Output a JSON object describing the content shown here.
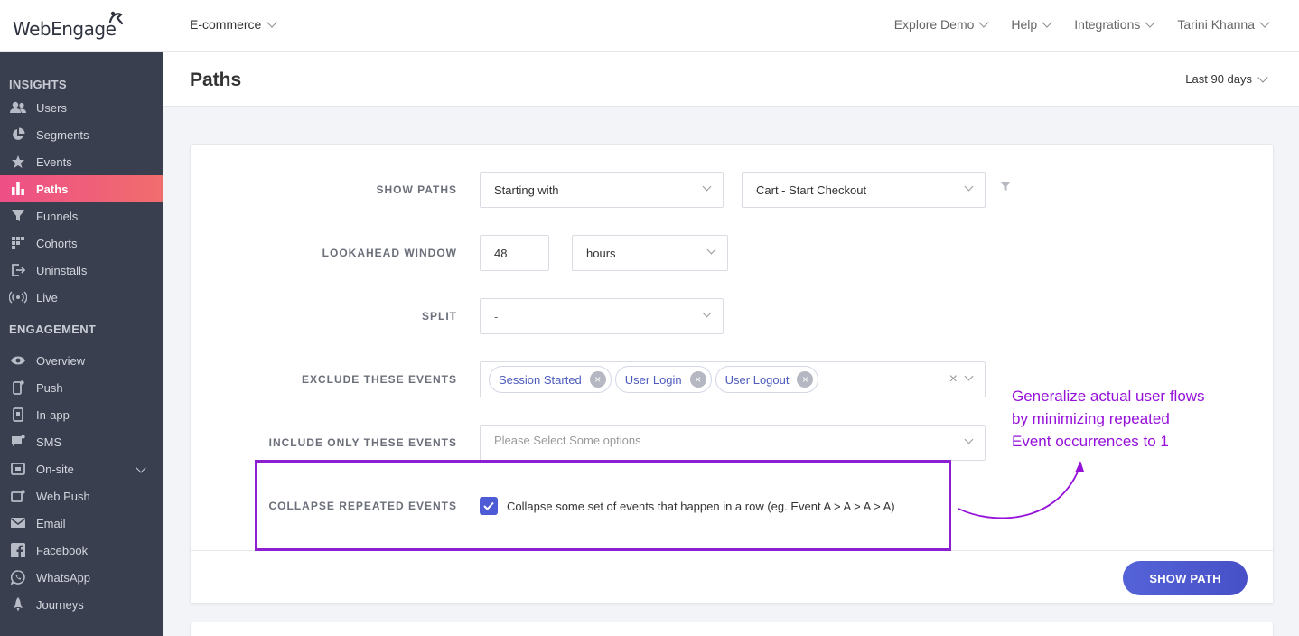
{
  "brand": {
    "name": "WebEngage"
  },
  "topbar": {
    "project": "E-commerce",
    "nav": [
      "Explore Demo",
      "Help",
      "Integrations",
      "Tarini Khanna"
    ]
  },
  "sidebar": {
    "insights_title": "INSIGHTS",
    "insights": [
      {
        "label": "Users",
        "icon": "users-icon"
      },
      {
        "label": "Segments",
        "icon": "pie-icon"
      },
      {
        "label": "Events",
        "icon": "star-icon"
      },
      {
        "label": "Paths",
        "icon": "bar-chart-icon",
        "active": true
      },
      {
        "label": "Funnels",
        "icon": "funnel-icon"
      },
      {
        "label": "Cohorts",
        "icon": "grid-icon"
      },
      {
        "label": "Uninstalls",
        "icon": "exit-icon"
      },
      {
        "label": "Live",
        "icon": "broadcast-icon"
      }
    ],
    "engagement_title": "ENGAGEMENT",
    "engagement": [
      {
        "label": "Overview",
        "icon": "eye-icon"
      },
      {
        "label": "Push",
        "icon": "mobile-icon"
      },
      {
        "label": "In-app",
        "icon": "in-app-icon"
      },
      {
        "label": "SMS",
        "icon": "chat-icon"
      },
      {
        "label": "On-site",
        "icon": "window-icon"
      },
      {
        "label": "Web Push",
        "icon": "web-push-icon"
      },
      {
        "label": "Email",
        "icon": "mail-icon"
      },
      {
        "label": "Facebook",
        "icon": "facebook-icon"
      },
      {
        "label": "WhatsApp",
        "icon": "whatsapp-icon"
      },
      {
        "label": "Journeys",
        "icon": "rocket-icon"
      }
    ]
  },
  "page": {
    "title": "Paths",
    "date_range": "Last 90 days"
  },
  "form": {
    "show_paths": {
      "label": "SHOW PATHS",
      "mode": "Starting with",
      "event": "Cart - Start Checkout"
    },
    "lookahead": {
      "label": "LOOKAHEAD WINDOW",
      "value": "48",
      "unit": "hours"
    },
    "split": {
      "label": "SPLIT",
      "value": "-"
    },
    "exclude": {
      "label": "EXCLUDE THESE EVENTS",
      "tags": [
        "Session Started",
        "User Login",
        "User Logout"
      ]
    },
    "include": {
      "label": "INCLUDE ONLY THESE EVENTS",
      "placeholder": "Please Select Some options"
    },
    "collapse": {
      "label": "COLLAPSE REPEATED EVENTS",
      "checked": true,
      "text": "Collapse some set of events that happen in a row (eg. Event A > A > A > A)"
    },
    "submit": "SHOW PATH"
  },
  "annotation": {
    "lines": [
      "Generalize actual user flows",
      "by minimizing repeated",
      "Event occurrences to 1"
    ],
    "color": "#9511d9"
  },
  "colors": {
    "sidebar_bg": "#3a3f4f",
    "active_gradient": [
      "#ee4f87",
      "#f06d6d"
    ],
    "primary": "#4d5bd6",
    "highlight": "#8c1fd1"
  }
}
